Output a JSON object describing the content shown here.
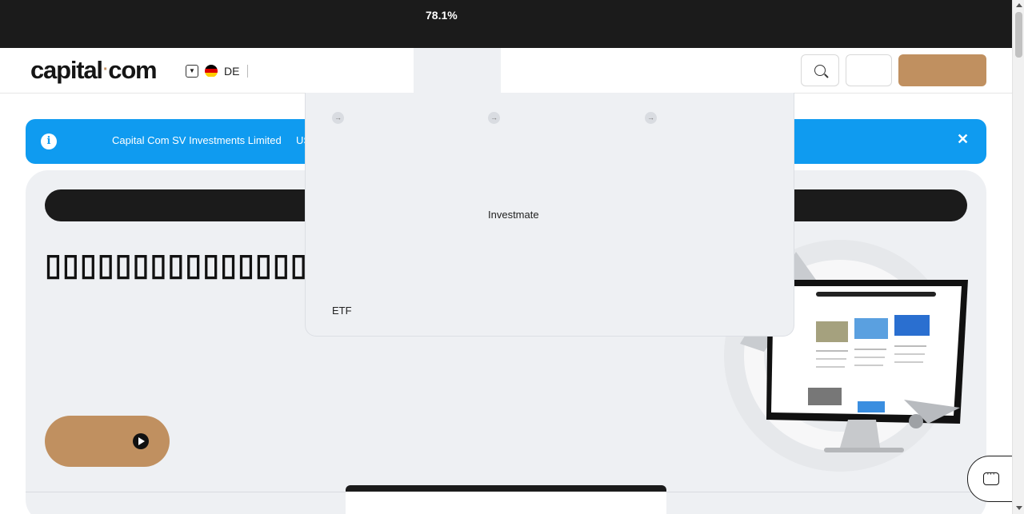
{
  "loading": {
    "percent": "78.1%"
  },
  "header": {
    "logo": {
      "left": "capital",
      "dot": "·",
      "right": "com"
    },
    "language": {
      "code": "DE",
      "flag_colors": [
        "#000000",
        "#dd0000",
        "#ffce00"
      ]
    },
    "search_icon": "search-icon"
  },
  "banner": {
    "info_icon": "i",
    "text": "Capital Com SV Investments Limited",
    "text_partial": "US",
    "close_icon": "✕",
    "color": "#0f9bf0"
  },
  "hero": {
    "title": "▯▯▯▯▯▯▯▯▯▯▯▯▯▯▯▯",
    "cta_color": "#c09060"
  },
  "dropdown": {
    "arrow_glyph": "→",
    "labels": {
      "investmate": "Investmate",
      "etf": "ETF"
    }
  },
  "chat": {
    "icon": "chat-icon"
  }
}
